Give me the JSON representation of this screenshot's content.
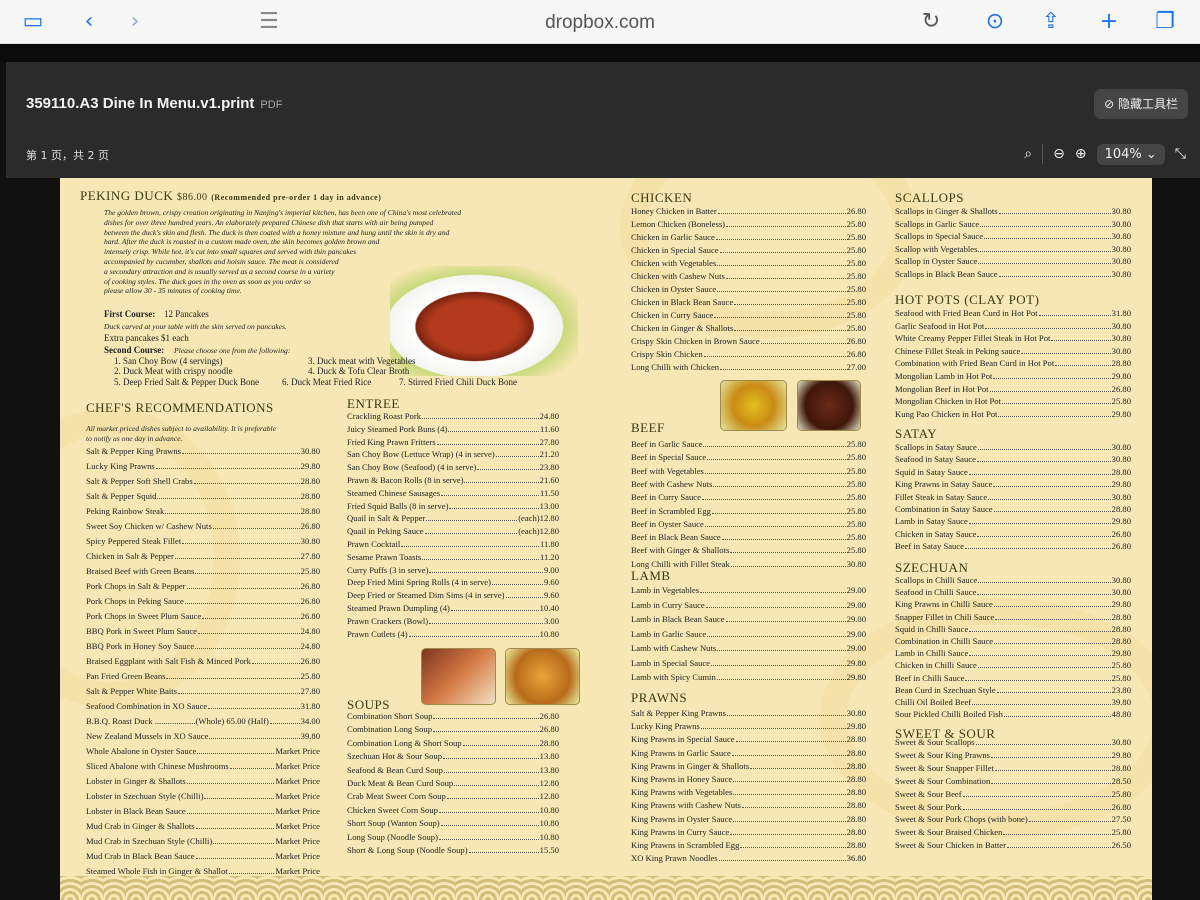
{
  "browser": {
    "url": "dropbox.com"
  },
  "viewer": {
    "title": "359110.A3 Dine In Menu.v1.print",
    "type": "PDF",
    "hide_toolbar": "隐藏工具栏",
    "page_info": "第 1 页，共 2 页",
    "zoom": "104%"
  },
  "peking": {
    "title": "PEKING DUCK",
    "price": "$86.00",
    "note": "(Recommended pre-order 1 day in advance)",
    "desc": [
      "The golden brown, crispy creation originating in Nanjing's imperial kitchen, has been one of China's most celebrated",
      "dishes for over three hundred years.  An elaborately prepared Chinese dish that starts with air being pumped",
      "between the duck's skin and flesh.  The duck is then coated with a honey mixture and hung until the skin is dry and",
      "hard.  After the duck is roasted in a custom made oven, the skin becomes golden brown and",
      "intensely crisp.  While hot, it's cut into small squares and served with thin pancakes",
      "accompanied by cucumber, shallots and hoisin sauce.  The meat is considered",
      "a secondary attraction and is usually served as a second course in a variety",
      "of cooking styles.  The duck goes in the oven as soon as you order so",
      "please allow 30 - 35 minutes of cooking time."
    ],
    "first_label": "First Course:",
    "first_val": "12 Pancakes",
    "first_note": "Duck carved at your table with the skin served on pancakes.",
    "extra": "Extra pancakes $1 each",
    "second_label": "Second Course:",
    "second_note": "Please choose one from the following:",
    "options": [
      "1. San Choy Bow (4 servings)",
      "3. Duck meat with Vegetables",
      "2. Duck Meat with crispy noodle",
      "4. Duck & Tofu Clear Broth",
      "5. Deep Fried Salt & Pepper Duck Bone",
      "6. Duck Meat Fried Rice",
      "7. Stirred Fried Chili Duck Bone"
    ]
  },
  "chef": {
    "title": "CHEF'S RECOMMENDATIONS",
    "note": [
      "All market priced dishes subject to availability.  It is preferable",
      "to notify us one day in advance."
    ],
    "items": [
      [
        "Salt & Pepper King Prawns",
        "30.80"
      ],
      [
        "Lucky King Prawns",
        "29.80"
      ],
      [
        "Salt & Pepper Soft Shell Crabs",
        "28.80"
      ],
      [
        "Salt & Pepper Squid",
        "28.80"
      ],
      [
        "Peking Rainbow Steak",
        "28.80"
      ],
      [
        "Sweet Soy Chicken w/ Cashew Nuts",
        "26.80"
      ],
      [
        "Spicy Peppered Steak Fillet",
        "30.80"
      ],
      [
        "Chicken in Salt & Pepper",
        "27.80"
      ],
      [
        "Braised Beef with Green Beans",
        "25.80"
      ],
      [
        "Pork Chops in Salt & Pepper",
        "26.80"
      ],
      [
        "Pork Chops in Peking Sauce",
        "26.80"
      ],
      [
        "Pork Chops in Sweet Plum Sauce",
        "26.80"
      ],
      [
        "BBQ Pork in Sweet Plum Sauce",
        "24.80"
      ],
      [
        "BBQ Pork in Honey Soy Sauce",
        "24.80"
      ],
      [
        "Braised Eggplant with Salt Fish & Minced Pork",
        "26.80"
      ],
      [
        "Pan Fried Green Beans",
        "25.80"
      ],
      [
        "Salt & Pepper White Baits",
        "27.80"
      ],
      [
        "Seafood Combination in XO Sauce",
        "31.80"
      ],
      [
        "B.B.Q. Roast Duck ...................(Whole) 65.00  (Half)",
        "34.00"
      ],
      [
        "New Zealand Mussels in XO Sauce",
        "39.80"
      ],
      [
        "Whole Abalone in Oyster Sauce",
        "Market Price"
      ],
      [
        "Sliced Abalone with Chinese Mushrooms",
        "Market Price"
      ],
      [
        "Lobster in Ginger & Shallots",
        "Market Price"
      ],
      [
        "Lobster in Szechuan Style (Chilli)",
        "Market Price"
      ],
      [
        "Lobster in Black Bean Sauce",
        "Market Price"
      ],
      [
        "Mud Crab in Ginger & Shallots",
        "Market Price"
      ],
      [
        "Mud Crab in Szechuan Style (Chilli)",
        "Market Price"
      ],
      [
        "Mud Crab in Black Bean Sauce",
        "Market Price"
      ],
      [
        "Steamed Whole Fish in Ginger & Shallot",
        "Market Price"
      ]
    ]
  },
  "entree": {
    "title": "ENTREE",
    "items": [
      [
        "Crackling Roast Pork",
        "24.80"
      ],
      [
        "Juicy Steamed Pork Buns (4)",
        "11.60"
      ],
      [
        "Fried King Prawn Fritters",
        "27.80"
      ],
      [
        "San Choy Bow (Lettuce Wrap) (4 in serve)",
        "21.20"
      ],
      [
        "San Choy Bow (Seafood) (4 in serve)",
        "23.80"
      ],
      [
        "Prawn & Bacon Rolls (8 in serve)",
        "21.60"
      ],
      [
        "Steamed Chinese Sausages",
        "11.50"
      ],
      [
        "Fried Squid Balls (8 in serve)",
        "13.00"
      ],
      [
        "Quail in Salt & Pepper",
        "(each)12.80"
      ],
      [
        "Quail in Peking Sauce",
        "(each)12.80"
      ],
      [
        "Prawn Cocktail",
        "11.80"
      ],
      [
        "Sesame Prawn Toasts",
        "11.20"
      ],
      [
        "Curry Puffs (3 in serve)",
        "9.00"
      ],
      [
        "Deep Fried Mini Spring Rolls (4 in serve)",
        "9.60"
      ],
      [
        "Deep Fried or Steamed Dim Sims (4 in serve)",
        "9.60"
      ],
      [
        "Steamed Prawn Dumpling (4)",
        "10.40"
      ],
      [
        "Prawn Crackers (Bowl)",
        "3.00"
      ],
      [
        "Prawn Cutlets (4)",
        "10.80"
      ]
    ]
  },
  "soups": {
    "title": "SOUPS",
    "items": [
      [
        "Combination Short Soup",
        "26.80"
      ],
      [
        "Combination Long Soup",
        "26.80"
      ],
      [
        "Combination Long & Short Soup",
        "28.80"
      ],
      [
        "Szechuan Hot & Sour Soup",
        "13.80"
      ],
      [
        "Seafood & Bean Curd Soup",
        "13.80"
      ],
      [
        "Duck Meat & Bean Curd Soup",
        "12.80"
      ],
      [
        "Crab Meat Sweet Corn Soup",
        "12.80"
      ],
      [
        "Chicken Sweet Corn  Soup",
        "10.80"
      ],
      [
        "Short Soup (Wanton Soup)",
        "10.80"
      ],
      [
        "Long Soup (Noodle Soup)",
        "10.80"
      ],
      [
        "Short & Long Soup (Noodle Soup)",
        "15.50"
      ]
    ]
  },
  "chicken": {
    "title": "CHICKEN",
    "items": [
      [
        "Honey Chicken in Batter",
        "26.80"
      ],
      [
        "Lemon Chicken (Boneless)",
        "25.80"
      ],
      [
        "Chicken in Garlic Sauce",
        "25.80"
      ],
      [
        "Chicken in Special Sauce",
        "25.80"
      ],
      [
        "Chicken with Vegetables",
        "25.80"
      ],
      [
        "Chicken with Cashew Nuts",
        "25.80"
      ],
      [
        "Chicken in Oyster Sauce",
        "25.80"
      ],
      [
        "Chicken in Black Bean Sauce",
        "25.80"
      ],
      [
        "Chicken in Curry Sauce",
        "25.80"
      ],
      [
        "Chicken in Ginger & Shallots",
        "25.80"
      ],
      [
        "Crispy Skin Chicken in Brown Sauce",
        "26.80"
      ],
      [
        "Crispy Skin Chicken",
        "26.80"
      ],
      [
        "Long Chilli with Chicken",
        "27.00"
      ]
    ]
  },
  "beef": {
    "title": "BEEF",
    "items": [
      [
        "Beef in Garlic Sauce",
        "25.80"
      ],
      [
        "Beef in Special Sauce",
        "25.80"
      ],
      [
        "Beef with Vegetables",
        "25.80"
      ],
      [
        "Beef with Cashew Nuts",
        "25.80"
      ],
      [
        "Beef in Curry Sauce",
        "25.80"
      ],
      [
        "Beef in Scrambled Egg",
        "25.80"
      ],
      [
        "Beef in Oyster Sauce",
        "25.80"
      ],
      [
        "Beef in Black Bean Sauce",
        "25.80"
      ],
      [
        "Beef with Ginger & Shallots",
        "25.80"
      ],
      [
        "Long Chilli with Fillet Steak",
        "30.80"
      ]
    ]
  },
  "lamb": {
    "title": "LAMB",
    "items": [
      [
        "Lamb in Vegetables",
        "29.00"
      ],
      [
        "Lamb in Curry Sauce",
        "29.00"
      ],
      [
        "Lamb in Black Bean Sauce",
        "29.00"
      ],
      [
        "Lamb in Garlic Sauce",
        "29.00"
      ],
      [
        "Lamb with Cashew Nuts",
        "29.00"
      ],
      [
        "Lamb in Special Sauce",
        "29.80"
      ],
      [
        "Lamb with Spicy Cumin",
        "29.80"
      ]
    ]
  },
  "prawns": {
    "title": "PRAWNS",
    "items": [
      [
        "Salt & Pepper King Prawns",
        "30.80"
      ],
      [
        "Lucky King Prawns",
        "29.80"
      ],
      [
        "King Prawns in Special Sauce",
        "28.80"
      ],
      [
        "King Prawns in Garlic Sauce",
        "28.80"
      ],
      [
        "King Prawns in Ginger & Shallots",
        "28.80"
      ],
      [
        "King Prawns in Honey Sauce",
        "28.80"
      ],
      [
        "King Prawns with Vegetables",
        "28.80"
      ],
      [
        "King Prawns with Cashew Nuts",
        "28.80"
      ],
      [
        "King Prawns in Oyster Sauce",
        "28.80"
      ],
      [
        "King Prawns in Curry Sauce",
        "28.80"
      ],
      [
        "King Prawns in Scrambled Egg",
        "28.80"
      ],
      [
        "XO King Prawn Noodles",
        "36.80"
      ]
    ]
  },
  "scallops": {
    "title": "SCALLOPS",
    "items": [
      [
        "Scallops in Ginger & Shallots",
        "30.80"
      ],
      [
        "Scallops in Garlic Sauce",
        "30.80"
      ],
      [
        "Scallops in Special Sauce",
        "30.80"
      ],
      [
        "Scallop with Vegetables",
        "30.80"
      ],
      [
        "Scallop in Oyster Sauce",
        "30.80"
      ],
      [
        "Scallops in Black Bean Sauce",
        "30.80"
      ]
    ]
  },
  "hotpots": {
    "title": "HOT POTS (CLAY POT)",
    "items": [
      [
        "Seafood with Fried Bean Curd in Hot Pot",
        "31.80"
      ],
      [
        "Garlic Seafood in Hot Pot",
        "30.80"
      ],
      [
        "White Creamy Pepper Fillet Steak in Hot Pot",
        "30.80"
      ],
      [
        "Chinese Fillet Steak in Peking sauce",
        "30.80"
      ],
      [
        "Combination with Fried Bean Curd in Hot Pot",
        "28.80"
      ],
      [
        "Mongolian Lamb in Hot Pot",
        "29.80"
      ],
      [
        "Mongolian Beef in Hot Pot",
        "26.80"
      ],
      [
        "Mongolian Chicken in Hot Pot",
        "25.80"
      ],
      [
        "Kung Pao Chicken in Hot Pot",
        "29.80"
      ]
    ]
  },
  "satay": {
    "title": "SATAY",
    "items": [
      [
        "Scallops in Satay Sauce",
        "30.80"
      ],
      [
        "Seafood in Satay Sauce",
        "30.80"
      ],
      [
        "Squid in Satay Sauce",
        "28.80"
      ],
      [
        "King Prawns in Satay Sauce",
        "29.80"
      ],
      [
        "Fillet Steak in Satay Sauce",
        "30.80"
      ],
      [
        "Combination in Satay Sauce",
        "28.80"
      ],
      [
        "Lamb in Satay Sauce",
        "29.80"
      ],
      [
        "Chicken in Satay Sauce",
        "26.80"
      ],
      [
        "Beef in Satay Sauce",
        "26.80"
      ]
    ]
  },
  "szechuan": {
    "title": "SZECHUAN",
    "items": [
      [
        "Scallops in Chilli Sauce",
        "30.80"
      ],
      [
        "Seafood in Chilli Sauce",
        "30.80"
      ],
      [
        "King Prawns in Chilli Sauce",
        "29.80"
      ],
      [
        "Snapper Fillet in Chili Sauce",
        "28.80"
      ],
      [
        "Squid in Chilli Sauce",
        "28.80"
      ],
      [
        "Combination in Chilli Sauce",
        "28.80"
      ],
      [
        "Lamb in Chilli Sauce",
        "29.80"
      ],
      [
        "Chicken in Chilli Sauce",
        "25.80"
      ],
      [
        "Beef in Chilli Sauce",
        "25.80"
      ],
      [
        "Bean Curd in Szechuan Style",
        "23.80"
      ],
      [
        "Chilli Oil Boiled Beef",
        "39.80"
      ],
      [
        "Sour Pickled Chilli Boiled Fish",
        "48.80"
      ]
    ]
  },
  "sweetsour": {
    "title": "SWEET & SOUR",
    "items": [
      [
        "Sweet & Sour Scallops",
        "30.80"
      ],
      [
        "Sweet & Sour King Prawns",
        "29.80"
      ],
      [
        "Sweet & Sour Snapper Fillet",
        "28.80"
      ],
      [
        "Sweet & Sour Combination",
        "28.50"
      ],
      [
        "Sweet & Sour Beef",
        "25.80"
      ],
      [
        "Sweet & Sour Pork",
        "26.80"
      ],
      [
        "Sweet & Sour Pork Chops (with bone)",
        "27.50"
      ],
      [
        "Sweet & Sour Braised Chicken",
        "25.80"
      ],
      [
        "Sweet & Sour Chicken in Batter",
        "26.50"
      ]
    ]
  }
}
